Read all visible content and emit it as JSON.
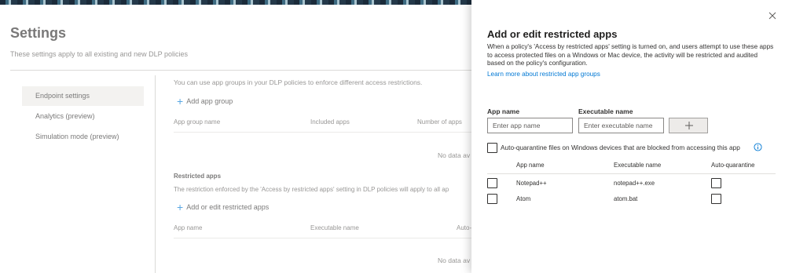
{
  "page": {
    "title": "Settings",
    "subtitle": "These settings apply to all existing and new DLP policies"
  },
  "sidenav": {
    "items": [
      {
        "label": "Endpoint settings",
        "selected": true
      },
      {
        "label": "Analytics (preview)",
        "selected": false
      },
      {
        "label": "Simulation mode (preview)",
        "selected": false
      }
    ]
  },
  "content": {
    "intro": "You can use app groups in your DLP policies to enforce different access restrictions.",
    "add_app_group": "Add app group",
    "groups_table": {
      "headers": [
        "App group name",
        "Included apps",
        "Number of apps"
      ],
      "empty": "No data av"
    },
    "restricted": {
      "title": "Restricted apps",
      "description": "The restriction enforced by the 'Access by restricted apps' setting in DLP policies will apply to all ap",
      "add_label": "Add or edit restricted apps",
      "headers": [
        "App name",
        "Executable name",
        "Auto-"
      ],
      "empty": "No data av"
    }
  },
  "panel": {
    "title": "Add or edit restricted apps",
    "description": "When a policy's 'Access by restricted apps' setting is turned on, and users attempt to use these apps to access protected files on a Windows or Mac device, the activity will be restricted and audited based on the policy's configuration.",
    "learn_more": "Learn more about restricted app groups",
    "app_name_label": "App name",
    "app_name_placeholder": "Enter app name",
    "exe_name_label": "Executable name",
    "exe_name_placeholder": "Enter executable name",
    "auto_quarantine_label": "Auto-quarantine files on Windows devices that are blocked from accessing this app",
    "table": {
      "headers": [
        "App name",
        "Executable name",
        "Auto-quarantine"
      ],
      "rows": [
        {
          "app": "Notepad++",
          "exe": "notepad++.exe",
          "auto_quarantine": false
        },
        {
          "app": "Atom",
          "exe": "atom.bat",
          "auto_quarantine": false
        }
      ]
    }
  },
  "icons": {
    "close": "close-icon",
    "add": "plus-icon",
    "info": "info-icon"
  },
  "colors": {
    "accent": "#0078d4",
    "text": "#323130",
    "nav_selected": "#edebe9"
  }
}
